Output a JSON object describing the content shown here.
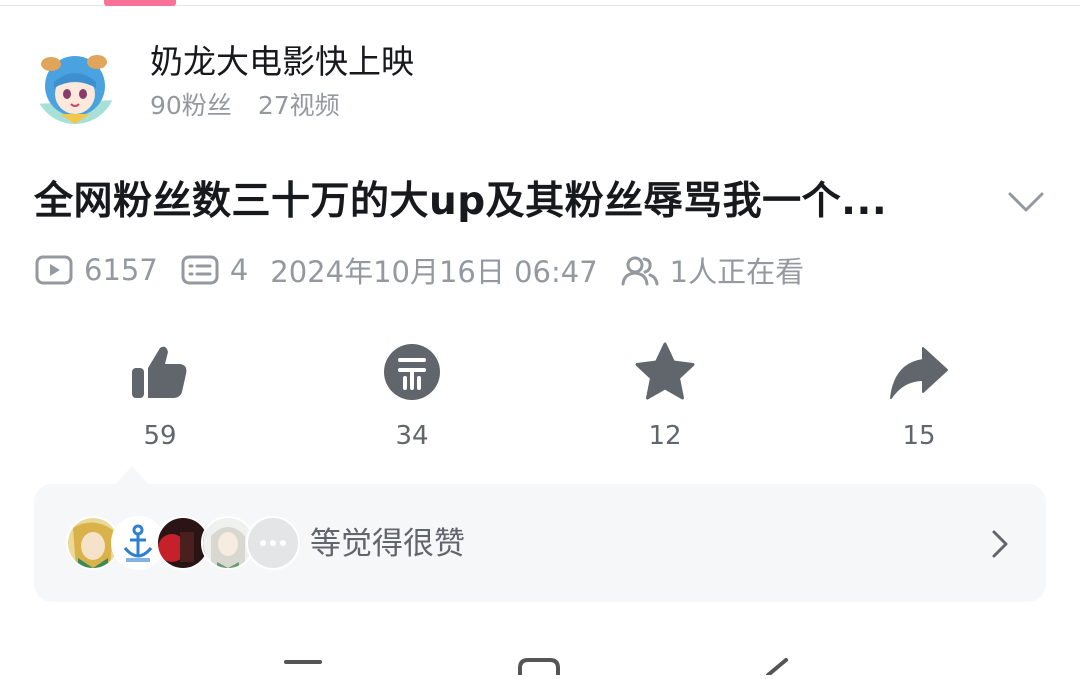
{
  "uploader": {
    "name": "奶龙大电影快上映",
    "followers": "90粉丝",
    "videos": "27视频"
  },
  "video": {
    "title": "全网粉丝数三十万的大up及其粉丝辱骂我一个...",
    "views": "6157",
    "comments": "4",
    "datetime": "2024年10月16日 06:47",
    "watching": "1人正在看"
  },
  "actions": {
    "like": "59",
    "coin": "34",
    "favorite": "12",
    "share": "15"
  },
  "likers": {
    "text": "等觉得很赞"
  },
  "colors": {
    "accent_pink": "#fb7299",
    "icon_gray": "#61666d",
    "meta_gray": "#9499a0",
    "panel_bg": "#f6f7f8"
  }
}
